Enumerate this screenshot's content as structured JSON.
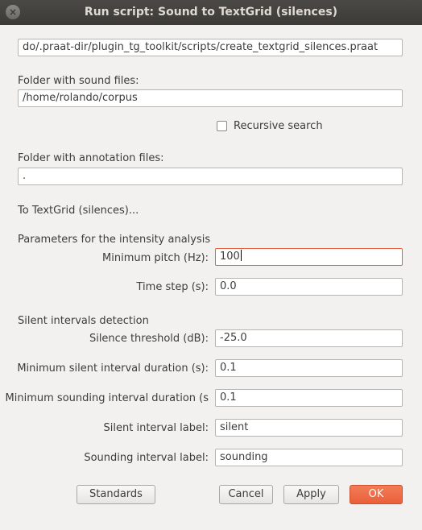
{
  "window": {
    "title": "Run script: Sound to TextGrid (silences)",
    "close_glyph": "×"
  },
  "script_path": "do/.praat-dir/plugin_tg_toolkit/scripts/create_textgrid_silences.praat",
  "sound_folder": {
    "label": "Folder with sound files:",
    "value": "/home/rolando/corpus"
  },
  "recursive": {
    "label": "Recursive search",
    "checked": false
  },
  "annotation_folder": {
    "label": "Folder with annotation files:",
    "value": "."
  },
  "section_heading": "To TextGrid (silences)...",
  "intensity": {
    "heading": "Parameters for the intensity analysis",
    "min_pitch": {
      "label": "Minimum pitch (Hz):",
      "value": "100"
    },
    "time_step": {
      "label": "Time step (s):",
      "value": "0.0"
    }
  },
  "silent": {
    "heading": "Silent intervals detection",
    "threshold": {
      "label": "Silence threshold (dB):",
      "value": "-25.0"
    },
    "min_silent": {
      "label": "Minimum silent interval duration (s):",
      "value": "0.1"
    },
    "min_sounding": {
      "label": "Minimum sounding interval duration (s",
      "value": "0.1"
    },
    "silent_label": {
      "label": "Silent interval label:",
      "value": "silent"
    },
    "sounding_label": {
      "label": "Sounding interval label:",
      "value": "sounding"
    }
  },
  "buttons": {
    "standards": "Standards",
    "cancel": "Cancel",
    "apply": "Apply",
    "ok": "OK"
  }
}
